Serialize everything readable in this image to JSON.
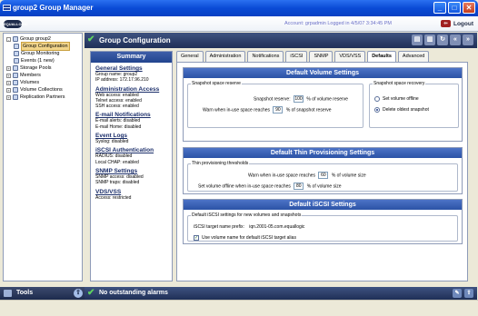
{
  "window": {
    "title": "group2 Group Manager",
    "minimize": "_",
    "maximize": "□",
    "close": "✕"
  },
  "header": {
    "logo": "EQUALLOGIC",
    "account": "Account: grpadmin   Logged in 4/5/07 3:34:45 PM",
    "logout": "Logout"
  },
  "tree": {
    "items": [
      {
        "label": "Group group2",
        "indent": 0,
        "expander": "-"
      },
      {
        "label": "Group Configuration",
        "indent": 1,
        "selected": true
      },
      {
        "label": "Group Monitoring",
        "indent": 1
      },
      {
        "label": "Events (1 new)",
        "indent": 1
      },
      {
        "label": "Storage Pools",
        "indent": 0,
        "expander": "+"
      },
      {
        "label": "Members",
        "indent": 0,
        "expander": "+"
      },
      {
        "label": "Volumes",
        "indent": 0,
        "expander": "+"
      },
      {
        "label": "Volume Collections",
        "indent": 0,
        "expander": "+"
      },
      {
        "label": "Replication Partners",
        "indent": 0,
        "expander": "+"
      }
    ]
  },
  "tools": {
    "label": "Tools",
    "up": "⇧"
  },
  "main": {
    "title": "Group Configuration"
  },
  "summary": {
    "title": "Summary",
    "sections": [
      {
        "heading": "General Settings",
        "lines": [
          "Group name: group2",
          "IP address: 172.17.96.210"
        ]
      },
      {
        "heading": "Administration Access",
        "lines": [
          "Web access: enabled",
          "Telnet access: enabled",
          "SSH access: enabled"
        ]
      },
      {
        "heading": "E-mail Notifications",
        "lines": [
          "E-mail alerts: disabled",
          "E-mail Home: disabled"
        ]
      },
      {
        "heading": "Event Logs",
        "lines": [
          "Syslog: disabled"
        ]
      },
      {
        "heading": "iSCSI Authentication",
        "lines": [
          "RADIUS: disabled",
          "Local CHAP: enabled"
        ]
      },
      {
        "heading": "SNMP Settings",
        "lines": [
          "SNMP access: disabled",
          "SNMP traps: disabled"
        ]
      },
      {
        "heading": "VDS/VSS",
        "lines": [
          "Access: restricted"
        ]
      }
    ]
  },
  "tabs": [
    "General",
    "Administration",
    "Notifications",
    "iSCSI",
    "SNMP",
    "VDS/VSS",
    "Defaults",
    "Advanced"
  ],
  "active_tab": "Defaults",
  "volume_settings": {
    "title": "Default Volume Settings",
    "snapshot_space_reserve": {
      "legend": "Snapshot space reserve",
      "reserve_label": "Snapshot reserve:",
      "reserve_value": "100",
      "reserve_unit": "% of volume reserve",
      "warn_label": "Warn when in-use space reaches",
      "warn_value": "90",
      "warn_unit": "% of snapshot reserve"
    },
    "snapshot_space_recovery": {
      "legend": "Snapshot space recovery",
      "option1": "Set volume offline",
      "option2": "Delete oldest snapshot",
      "selected": "Delete oldest snapshot"
    }
  },
  "thin_settings": {
    "title": "Default Thin Provisioning Settings",
    "legend": "Thin provisioning thresholds",
    "warn_label": "Warn when in-use space reaches",
    "warn_value": "60",
    "warn_unit": "% of volume size",
    "offline_label": "Set volume offline when in-use space reaches",
    "offline_value": "80",
    "offline_unit": "% of volume size"
  },
  "iscsi_settings": {
    "title": "Default iSCSI Settings",
    "legend": "Default iSCSI settings for new volumes and snapshots",
    "prefix_label": "iSCSI target name prefix:",
    "prefix_value": "iqn.2001-05.com.equallogic",
    "checkbox_label": "Use volume name for default iSCSI target alias",
    "checkbox_checked": true
  },
  "status": {
    "text": "No outstanding alarms"
  }
}
